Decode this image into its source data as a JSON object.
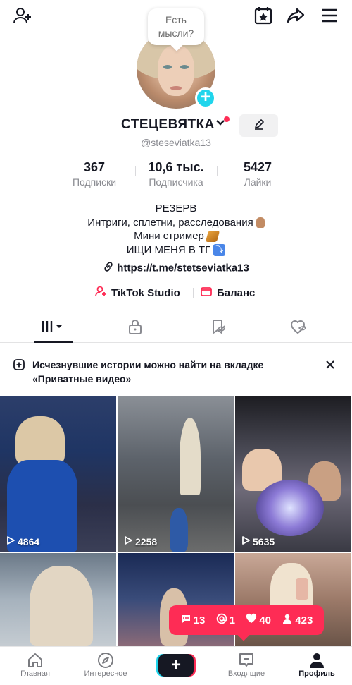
{
  "header": {
    "icons": [
      "add-friend-icon",
      "calendar-star-icon",
      "share-icon",
      "menu-icon"
    ]
  },
  "profile": {
    "thought_bubble": "Есть мысли?",
    "display_name": "СТЕЦЕВЯТКА",
    "username": "@steseviatka13",
    "stats": [
      {
        "value": "367",
        "label": "Подписки"
      },
      {
        "value": "10,6 тыс.",
        "label": "Подписчика"
      },
      {
        "value": "5427",
        "label": "Лайки"
      }
    ],
    "bio": [
      "РЕЗЕРВ",
      "Интриги, сплетни, расследования",
      "Мини стример",
      "ИЩИ МЕНЯ В ТГ"
    ],
    "link": "https://t.me/stetseviatka13",
    "tools": [
      {
        "label": "TikTok Studio",
        "icon": "studio-icon"
      },
      {
        "label": "Баланс",
        "icon": "wallet-icon"
      }
    ]
  },
  "tabs": [
    "videos-grid-icon",
    "lock-icon",
    "saved-icon",
    "liked-icon"
  ],
  "notice": {
    "text": "Исчезнувшие истории можно найти на вкладке «Приватные видео»"
  },
  "videos": [
    {
      "views": "4864"
    },
    {
      "views": "2258"
    },
    {
      "views": "5635"
    },
    {
      "views": ""
    },
    {
      "views": ""
    },
    {
      "views": ""
    }
  ],
  "notification": {
    "comments": "13",
    "mentions": "1",
    "likes": "40",
    "followers": "423"
  },
  "bottom_nav": [
    {
      "label": "Главная"
    },
    {
      "label": "Интересное"
    },
    {
      "label": ""
    },
    {
      "label": "Входящие"
    },
    {
      "label": "Профиль"
    }
  ],
  "colors": {
    "accent_red": "#fe2c55",
    "accent_cyan": "#20d5ec",
    "text_primary": "#161823",
    "text_secondary": "#8a8b91"
  }
}
